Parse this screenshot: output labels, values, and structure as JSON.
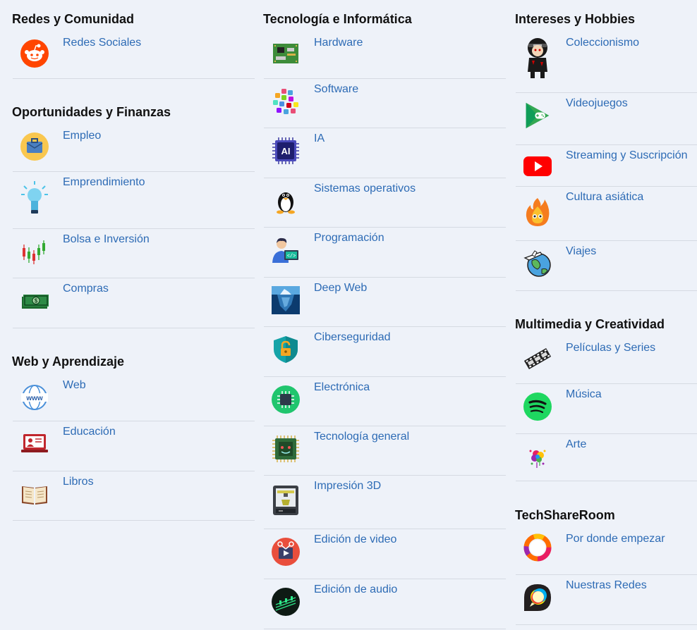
{
  "columns": [
    {
      "sections": [
        {
          "title": "Redes y Comunidad",
          "items": [
            {
              "label": "Redes Sociales",
              "icon": "reddit-icon"
            }
          ]
        },
        {
          "title": "Oportunidades y Finanzas",
          "items": [
            {
              "label": "Empleo",
              "icon": "briefcase-icon"
            },
            {
              "label": "Emprendimiento",
              "icon": "lightbulb-icon"
            },
            {
              "label": "Bolsa e Inversión",
              "icon": "candlestick-icon"
            },
            {
              "label": "Compras",
              "icon": "money-icon"
            }
          ]
        },
        {
          "title": "Web y Aprendizaje",
          "items": [
            {
              "label": "Web",
              "icon": "www-globe-icon"
            },
            {
              "label": "Educación",
              "icon": "teacher-screen-icon"
            },
            {
              "label": "Libros",
              "icon": "open-book-icon"
            }
          ]
        }
      ]
    },
    {
      "sections": [
        {
          "title": "Tecnología e Informática",
          "items": [
            {
              "label": "Hardware",
              "icon": "circuit-board-icon"
            },
            {
              "label": "Software",
              "icon": "app-icons-icon"
            },
            {
              "label": "IA",
              "icon": "ai-chip-icon"
            },
            {
              "label": "Sistemas operativos",
              "icon": "tux-penguin-icon"
            },
            {
              "label": "Programación",
              "icon": "programmer-icon"
            },
            {
              "label": "Deep Web",
              "icon": "iceberg-icon"
            },
            {
              "label": "Ciberseguridad",
              "icon": "shield-lock-icon"
            },
            {
              "label": "Electrónica",
              "icon": "chip-icon"
            },
            {
              "label": "Tecnología general",
              "icon": "processor-icon"
            },
            {
              "label": "Impresión 3D",
              "icon": "3d-printer-icon"
            },
            {
              "label": "Edición de video",
              "icon": "video-editing-icon"
            },
            {
              "label": "Edición de audio",
              "icon": "audio-editing-icon"
            }
          ]
        }
      ]
    },
    {
      "sections": [
        {
          "title": "Intereses y Hobbies",
          "items": [
            {
              "label": "Coleccionismo",
              "icon": "figure-icon"
            },
            {
              "label": "Videojuegos",
              "icon": "play-games-icon"
            },
            {
              "label": "Streaming y Suscripción",
              "icon": "youtube-icon"
            },
            {
              "label": "Cultura asiática",
              "icon": "fire-spirit-icon"
            },
            {
              "label": "Viajes",
              "icon": "globe-plane-icon"
            }
          ]
        },
        {
          "title": "Multimedia y Creatividad",
          "items": [
            {
              "label": "Películas y Series",
              "icon": "film-strip-icon"
            },
            {
              "label": "Música",
              "icon": "spotify-icon"
            },
            {
              "label": "Arte",
              "icon": "paint-splash-icon"
            }
          ]
        },
        {
          "title": "TechShareRoom",
          "items": [
            {
              "label": "Por donde empezar",
              "icon": "ring-icon"
            },
            {
              "label": "Nuestras Redes",
              "icon": "chat-bubble-icon"
            }
          ]
        }
      ]
    }
  ]
}
